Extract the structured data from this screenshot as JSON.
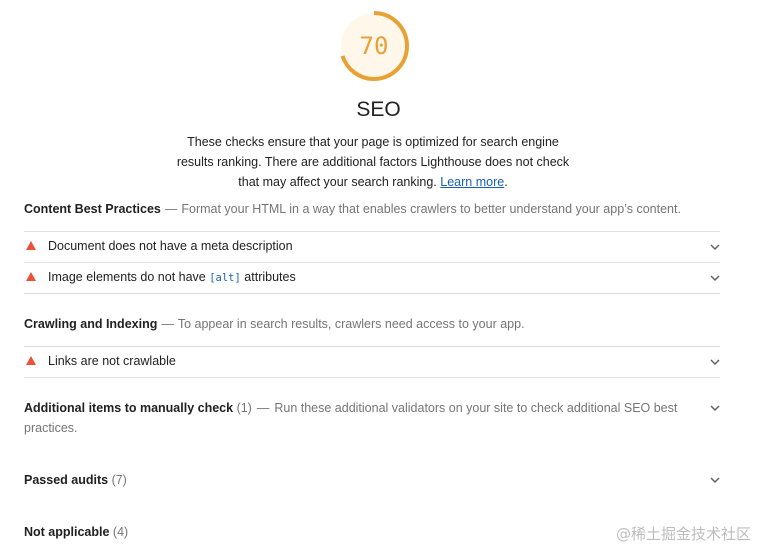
{
  "score": {
    "value": "70",
    "fraction": 0.7,
    "color": "#e8a134"
  },
  "category": {
    "title": "SEO",
    "description": "These checks ensure that your page is optimized for search engine results ranking. There are additional factors Lighthouse does not check that may affect your search ranking.",
    "learn_more": "Learn more",
    "period": "."
  },
  "groups": {
    "content": {
      "title": "Content Best Practices",
      "dash": "—",
      "description": "Format your HTML in a way that enables crawlers to better understand your app’s content."
    },
    "crawling": {
      "title": "Crawling and Indexing",
      "dash": "—",
      "description": "To appear in search results, crawlers need access to your app."
    },
    "manual": {
      "title": "Additional items to manually check",
      "count": "(1)",
      "dash": "—",
      "description": "Run these additional validators on your site to check additional SEO best practices."
    },
    "passed": {
      "title": "Passed audits",
      "count": "(7)"
    },
    "not_applicable": {
      "title": "Not applicable",
      "count": "(4)"
    }
  },
  "audits": {
    "meta_description": {
      "label": "Document does not have a meta description"
    },
    "image_alt": {
      "label_before": "Image elements do not have ",
      "code": "[alt]",
      "label_after": " attributes"
    },
    "links_crawlable": {
      "label": "Links are not crawlable"
    }
  },
  "colors": {
    "fail": "#e8513b",
    "average": "#e8a134",
    "link": "#1a5fb4"
  },
  "watermark": "@稀土掘金技术社区"
}
